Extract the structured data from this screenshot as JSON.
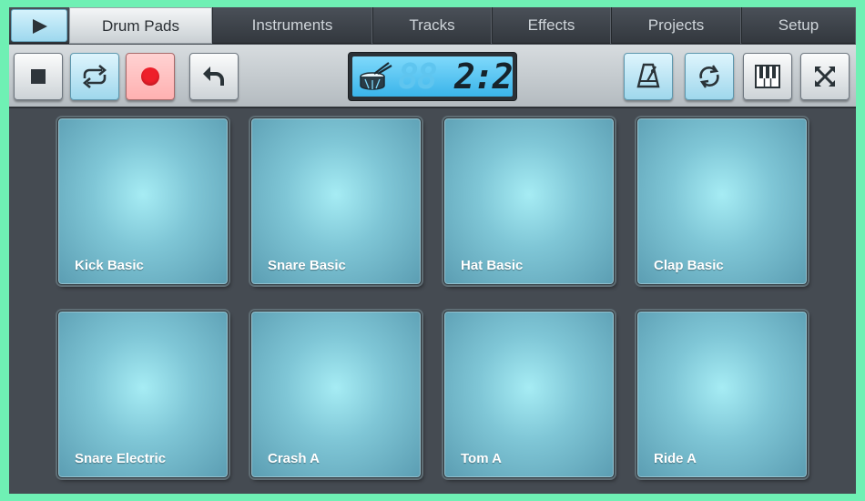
{
  "tabs": [
    {
      "label": "Drum Pads",
      "active": true
    },
    {
      "label": "Instruments",
      "active": false
    },
    {
      "label": "Tracks",
      "active": false
    },
    {
      "label": "Effects",
      "active": false
    },
    {
      "label": "Projects",
      "active": false
    },
    {
      "label": "Setup",
      "active": false
    }
  ],
  "toolbar": {
    "icons": {
      "play": "play-icon",
      "stop": "stop-icon",
      "loop": "loop-icon",
      "record": "record-icon",
      "undo": "undo-icon",
      "metronome": "metronome-icon",
      "sync": "sync-icon",
      "piano": "piano-icon",
      "fullscreen": "fullscreen-icon"
    },
    "display": {
      "ghost_digits": "88",
      "value": "2:2",
      "icon": "drum-icon"
    }
  },
  "pads": [
    {
      "label": "Kick Basic"
    },
    {
      "label": "Snare Basic"
    },
    {
      "label": "Hat Basic"
    },
    {
      "label": "Clap Basic"
    },
    {
      "label": "Snare Electric"
    },
    {
      "label": "Crash A"
    },
    {
      "label": "Tom A"
    },
    {
      "label": "Ride A"
    }
  ],
  "colors": {
    "background": "#6ff0b4",
    "pad": "#7fc6d6",
    "lcd": "#3ab4ea",
    "record": "#ee1f2a",
    "active_button": "#9fd7ec"
  }
}
